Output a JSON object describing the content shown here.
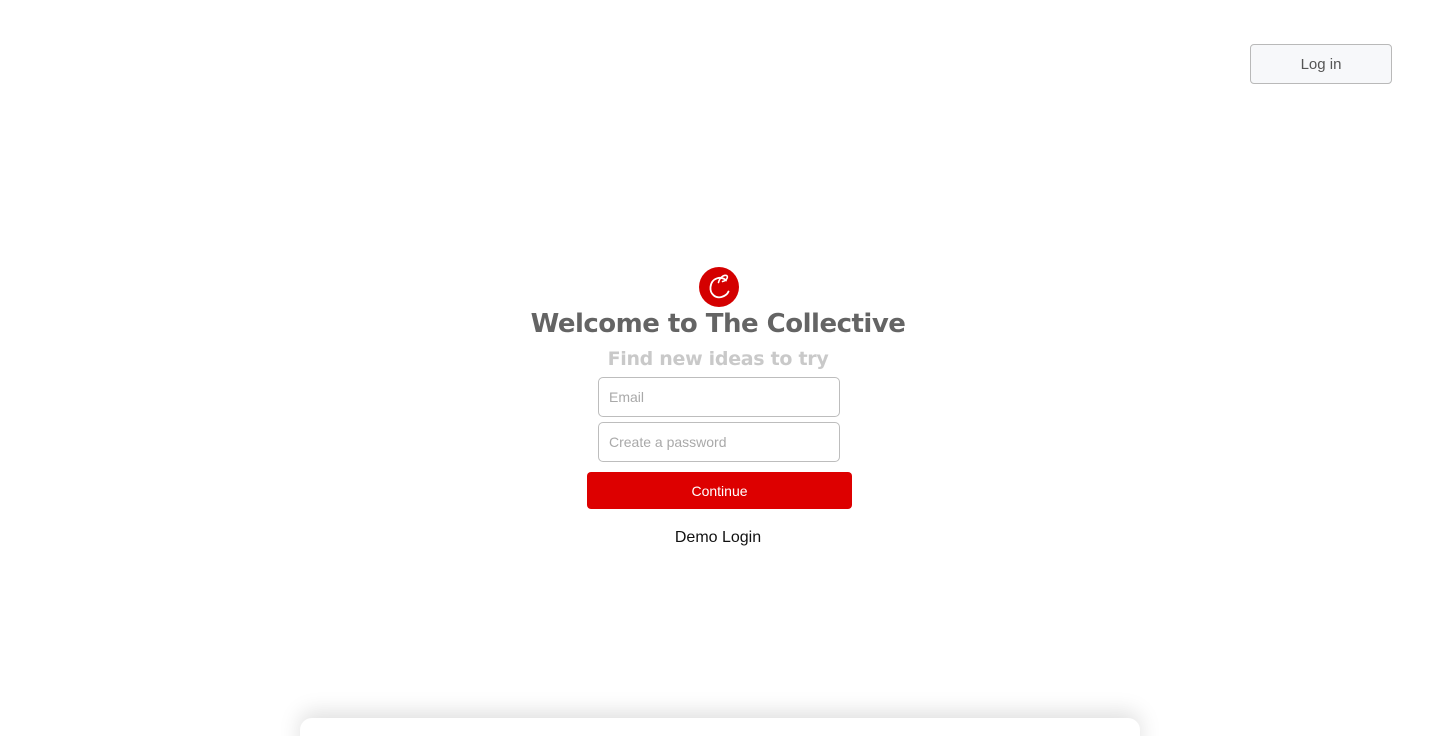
{
  "header": {
    "login_label": "Log in"
  },
  "brand": {
    "logo_icon": "collective-logo-icon",
    "logo_color": "#d40000"
  },
  "main": {
    "title": "Welcome to The Collective",
    "subtitle": "Find new ideas to try",
    "email": {
      "value": "",
      "placeholder": "Email"
    },
    "password": {
      "value": "",
      "placeholder": "Create a password"
    },
    "continue_label": "Continue",
    "demo_login_label": "Demo Login"
  },
  "colors": {
    "accent": "#dd0000",
    "title": "#646464",
    "subtitle": "#c9c9c9"
  }
}
